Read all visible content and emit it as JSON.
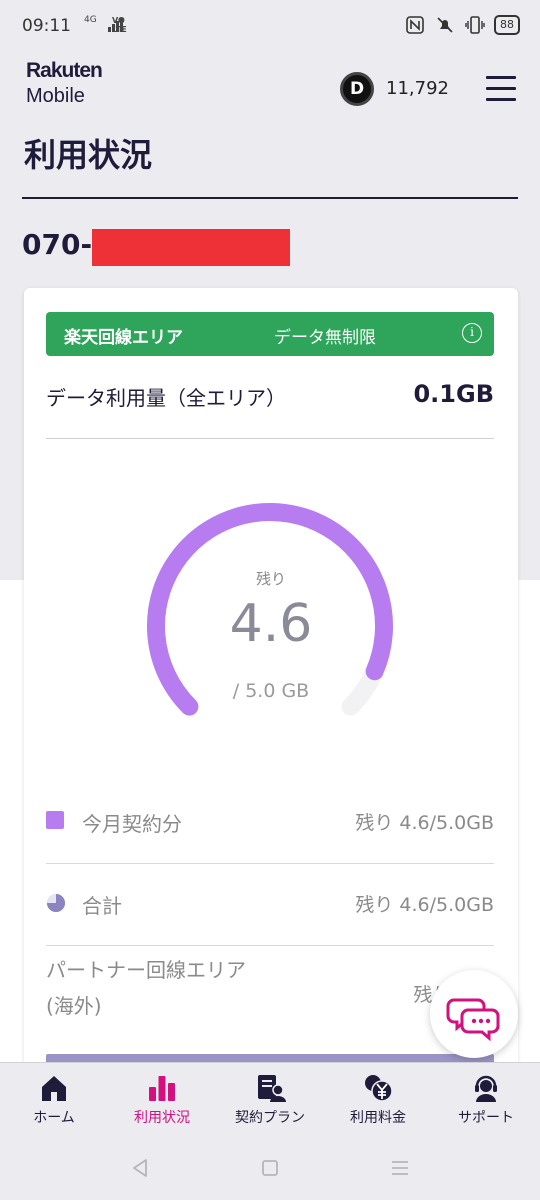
{
  "status_bar": {
    "time": "09:11",
    "network": "4G",
    "volte_top": "VO",
    "volte_bottom": "LTE",
    "battery": "88",
    "icons": [
      "nfc-icon",
      "mute-icon",
      "vibrate-icon",
      "battery-icon"
    ]
  },
  "header": {
    "logo_line1": "Rakuten",
    "logo_line2": "Mobile",
    "points_badge": "D",
    "points": "11,792"
  },
  "page": {
    "title": "利用状況",
    "phone_prefix": "070-"
  },
  "card": {
    "area_name": "楽天回線エリア",
    "area_plan": "データ無制限",
    "info_symbol": "i",
    "usage_label": "データ利用量（全エリア）",
    "usage_value": "0.1GB"
  },
  "gauge": {
    "remaining_label": "残り",
    "remaining_value": "4.6",
    "total_label": "/ 5.0 GB",
    "remaining_gb": 4.6,
    "total_gb": 5.0
  },
  "rows": [
    {
      "label": "今月契約分",
      "value": "残り 4.6/5.0GB",
      "icon": "square-icon"
    },
    {
      "label": "合計",
      "value": "残り 4.6/5.0GB",
      "icon": "pie-icon"
    },
    {
      "label_line1": "パートナー回線エリア",
      "label_line2": "(海外)",
      "value": "残り 2.0/"
    }
  ],
  "tabs": [
    {
      "label": "ホーム",
      "icon": "home-icon"
    },
    {
      "label": "利用状況",
      "icon": "bar-chart-icon",
      "active": true
    },
    {
      "label": "契約プラン",
      "icon": "contract-icon"
    },
    {
      "label": "利用料金",
      "icon": "fee-icon"
    },
    {
      "label": "サポート",
      "icon": "support-icon"
    }
  ],
  "colors": {
    "brand_navy": "#1f1b3a",
    "area_green": "#2ea55a",
    "gauge_purple": "#b77cf0",
    "active_tab": "#d2107e",
    "redaction": "#ee3137"
  }
}
